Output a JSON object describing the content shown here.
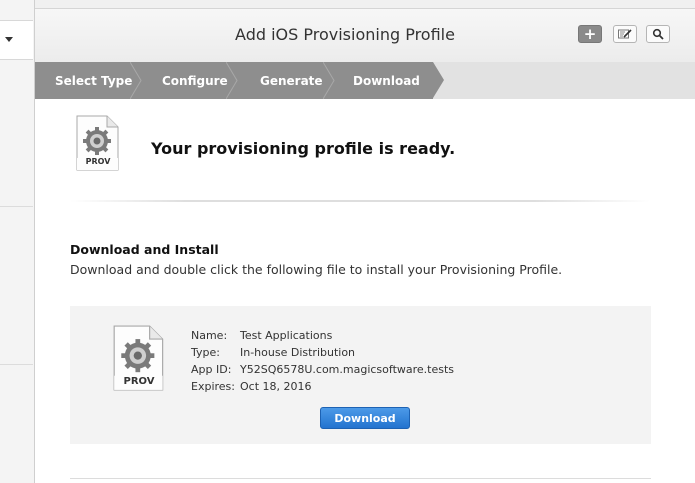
{
  "header": {
    "title": "Add iOS Provisioning Profile",
    "add_icon": "plus-icon",
    "edit_icon": "edit-icon",
    "search_icon": "search-icon",
    "add_glyph": "+"
  },
  "steps": [
    "Select Type",
    "Configure",
    "Generate",
    "Download"
  ],
  "ready": {
    "title": "Your provisioning profile is ready.",
    "icon_label": "PROV"
  },
  "download_section": {
    "title": "Download and Install",
    "description": "Download and double click the following file to install your Provisioning Profile."
  },
  "profile": {
    "icon_label": "PROV",
    "fields": [
      {
        "label": "Name:",
        "value": "Test Applications"
      },
      {
        "label": "Type:",
        "value": "In-house Distribution"
      },
      {
        "label": "App ID:",
        "value": "Y52SQ6578U.com.magicsoftware.tests"
      },
      {
        "label": "Expires:",
        "value": "Oct 18, 2016"
      }
    ],
    "download_label": "Download"
  },
  "colors": {
    "accent": "#2373cf",
    "steps_done": "#8e8e8e"
  }
}
